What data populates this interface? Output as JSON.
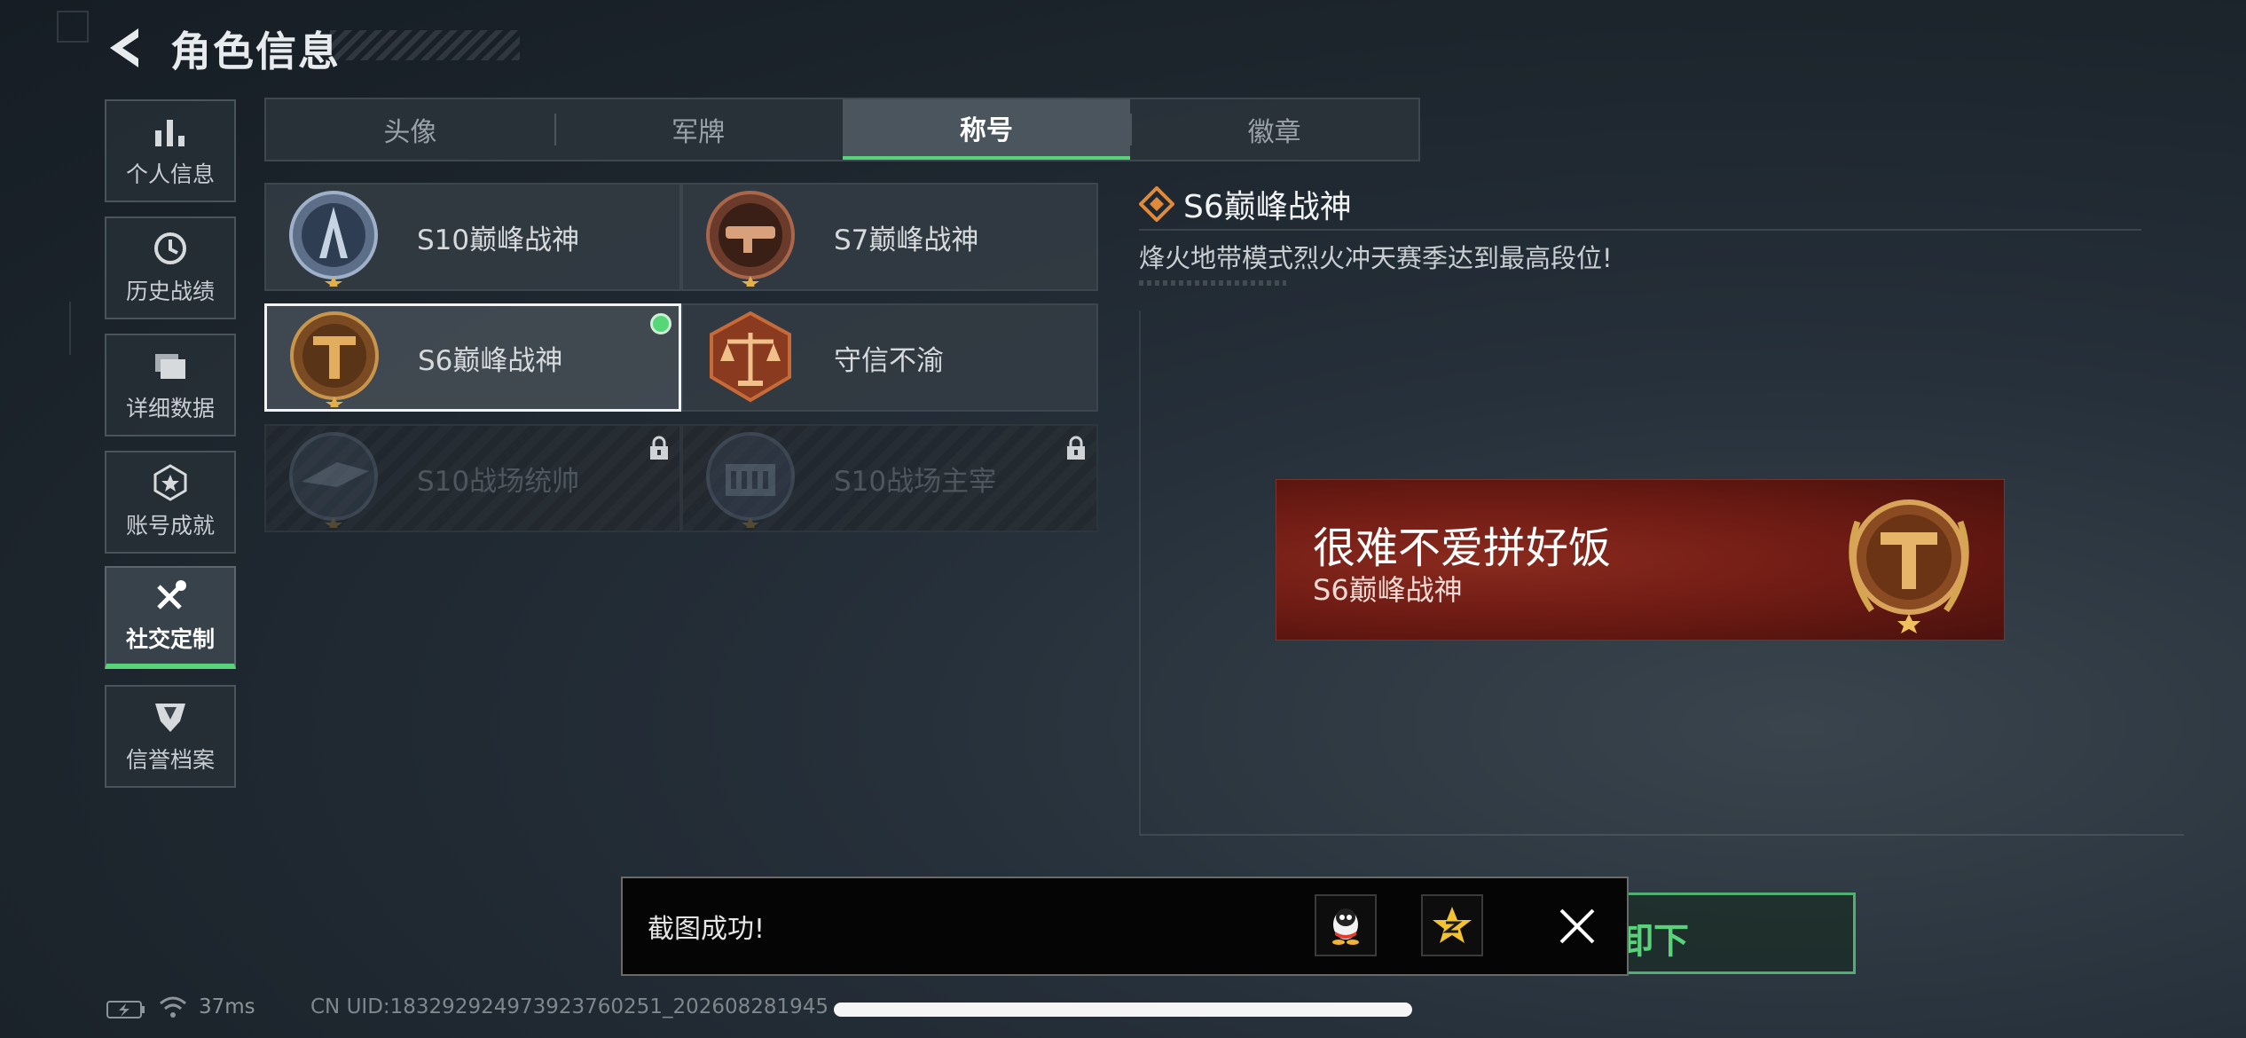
{
  "header": {
    "title": "角色信息"
  },
  "sidebar": {
    "items": [
      {
        "label": "个人信息",
        "icon": "bar-chart-icon",
        "active": false
      },
      {
        "label": "历史战绩",
        "icon": "clock-icon",
        "active": false
      },
      {
        "label": "详细数据",
        "icon": "folder-icon",
        "active": false
      },
      {
        "label": "账号成就",
        "icon": "achievement-icon",
        "active": false
      },
      {
        "label": "社交定制",
        "icon": "tools-icon",
        "active": true
      },
      {
        "label": "信誉档案",
        "icon": "shield-icon",
        "active": false
      }
    ]
  },
  "tabs": [
    {
      "label": "头像",
      "active": false
    },
    {
      "label": "军牌",
      "active": false
    },
    {
      "label": "称号",
      "active": true
    },
    {
      "label": "徽章",
      "active": false
    }
  ],
  "titles": [
    {
      "name": "S10巅峰战神",
      "emblem": "s10-peak-emblem",
      "selected": false,
      "locked": false
    },
    {
      "name": "S7巅峰战神",
      "emblem": "s7-peak-emblem",
      "selected": false,
      "locked": false
    },
    {
      "name": "S6巅峰战神",
      "emblem": "s6-peak-emblem",
      "selected": true,
      "locked": false
    },
    {
      "name": "守信不渝",
      "emblem": "scales-emblem",
      "selected": false,
      "locked": false
    },
    {
      "name": "S10战场统帅",
      "emblem": "s10-commander-emblem",
      "selected": false,
      "locked": true
    },
    {
      "name": "S10战场主宰",
      "emblem": "s10-dominator-emblem",
      "selected": false,
      "locked": true
    }
  ],
  "detail": {
    "title": "S6巅峰战神",
    "description": "烽火地带模式烈火冲天赛季达到最高段位!"
  },
  "banner": {
    "player_name": "很难不爱拼好饭",
    "title": "S6巅峰战神",
    "bg_color": "#6b1a13"
  },
  "toast": {
    "message": "截图成功!",
    "share_icons": [
      "qq-icon",
      "qzone-icon"
    ]
  },
  "hidden_button": {
    "partial_label": "卸下"
  },
  "status": {
    "ping": "37ms",
    "uid": "CN UID:1832929249739237602​51_202608281945"
  },
  "colors": {
    "accent": "#58d37a",
    "locked_text": "#4f575e",
    "banner_red": "#6b1a13"
  }
}
